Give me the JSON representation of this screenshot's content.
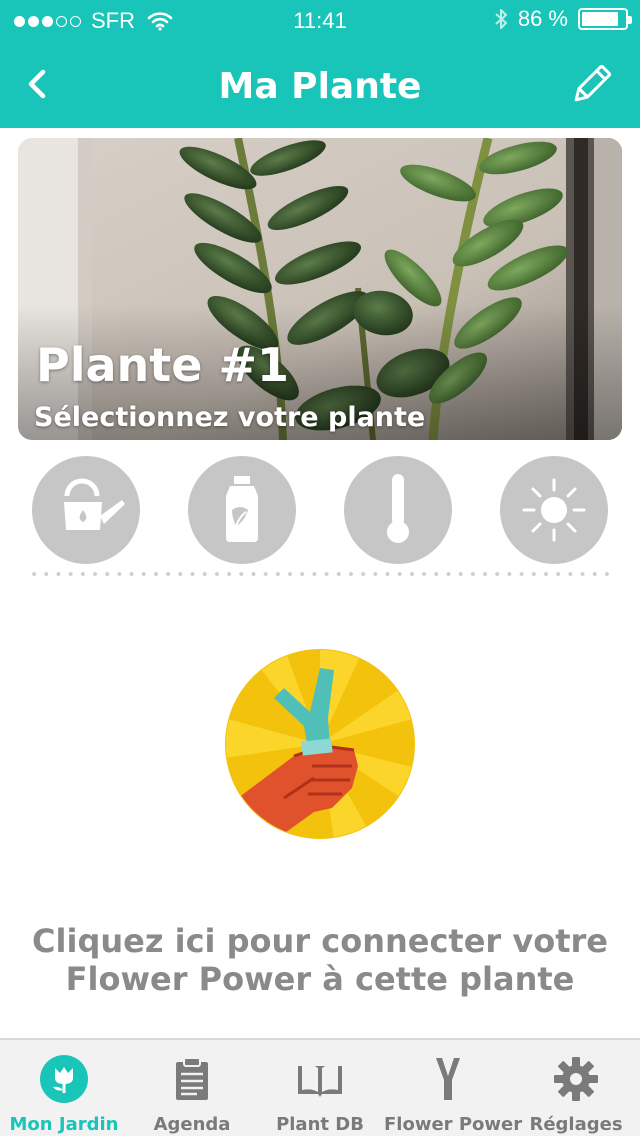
{
  "status_bar": {
    "carrier": "SFR",
    "time": "11:41",
    "battery_percent": "86 %",
    "battery_level": 0.86
  },
  "header": {
    "title": "Ma Plante",
    "back_icon": "chevron-left-icon",
    "edit_icon": "pencil-icon"
  },
  "plant": {
    "name": "Plante #1",
    "subtitle": "Sélectionnez votre plante"
  },
  "sensors": [
    "watering-can-icon",
    "fertilizer-bottle-icon",
    "thermometer-icon",
    "sun-icon"
  ],
  "connect": {
    "text": "Cliquez ici pour connecter votre Flower Power à cette plante"
  },
  "tabbar": {
    "active_color": "#19c4b8",
    "items": [
      {
        "label": "Mon Jardin",
        "icon": "tulip-icon"
      },
      {
        "label": "Agenda",
        "icon": "clipboard-icon"
      },
      {
        "label": "Plant DB",
        "icon": "open-book-icon"
      },
      {
        "label": "Flower Power",
        "icon": "flower-power-y-icon"
      },
      {
        "label": "Réglages",
        "icon": "gear-icon"
      }
    ]
  }
}
